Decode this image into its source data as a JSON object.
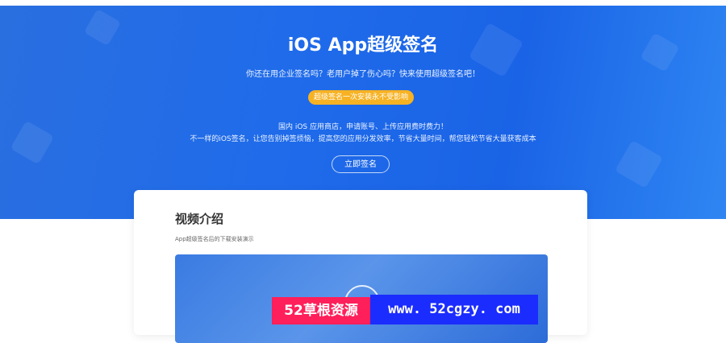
{
  "hero": {
    "title": "iOS App超级签名",
    "subtitle": "你还在用企业签名吗？老用户掉了伤心吗？快来使用超级签名吧！",
    "badge": "超级签名一次安装永不受影响",
    "desc_line1": "国内 iOS 应用商店，申请账号、上传应用费时费力！",
    "desc_line2": "不一样的iOS签名，让您告别掉签烦恼，提高您的应用分发效率，节省大量时间，帮您轻松节省大量获客成本",
    "cta_label": "立即签名"
  },
  "video_section": {
    "title": "视频介绍",
    "subtitle": "App超级签名后的下载安装演示"
  },
  "watermark": {
    "left": "52草根资源",
    "right": "www. 52cgzy. com"
  },
  "colors": {
    "hero_blue": "#1f6bea",
    "badge_orange": "#f7b223",
    "watermark_pink": "#ff1f5a",
    "watermark_blue": "#1b2cff"
  }
}
